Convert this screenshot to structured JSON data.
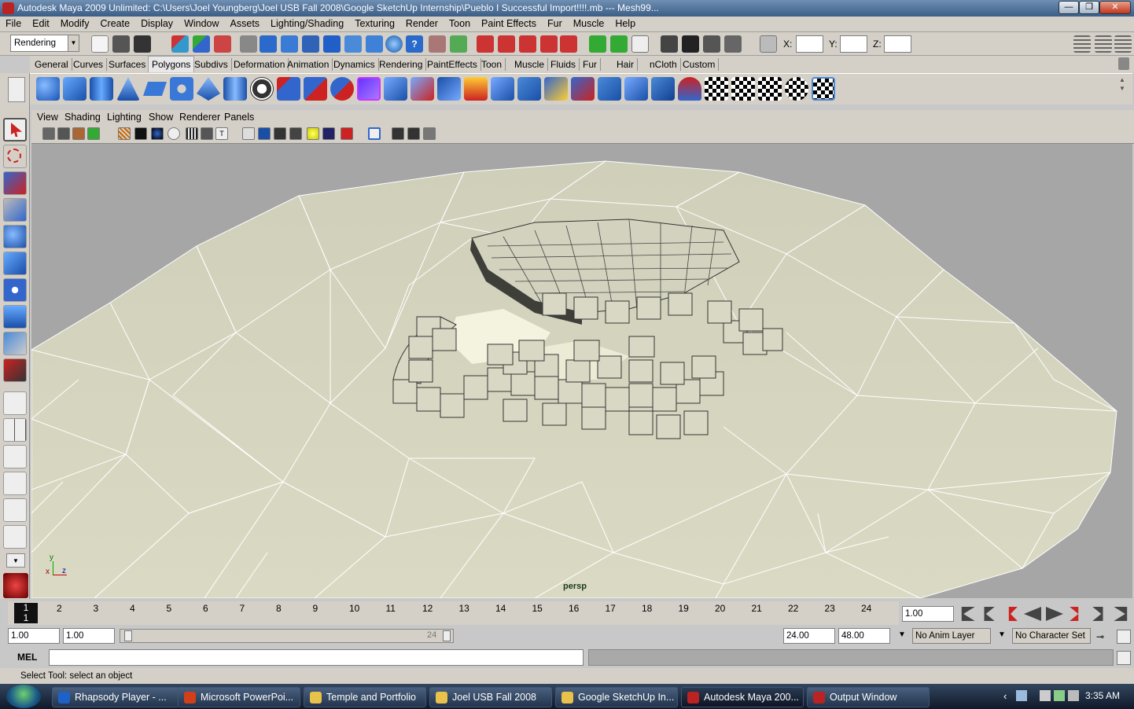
{
  "window": {
    "title": "Autodesk Maya 2009 Unlimited: C:\\Users\\Joel Youngberg\\Joel USB Fall 2008\\Google SketchUp Internship\\Pueblo I Successful Import!!!!.mb   ---   Mesh99...",
    "minimize": "—",
    "maximize": "❐",
    "close": "✕"
  },
  "menubar": [
    "File",
    "Edit",
    "Modify",
    "Create",
    "Display",
    "Window",
    "Assets",
    "Lighting/Shading",
    "Texturing",
    "Render",
    "Toon",
    "Paint Effects",
    "Fur",
    "Muscle",
    "Help"
  ],
  "statusline": {
    "menuset": "Rendering",
    "x_label": "X:",
    "y_label": "Y:",
    "z_label": "Z:"
  },
  "shelf_tabs": [
    "General",
    "Curves",
    "Surfaces",
    "Polygons",
    "Subdivs",
    "Deformation",
    "Animation",
    "Dynamics",
    "Rendering",
    "PaintEffects",
    "Toon",
    "Muscle",
    "Fluids",
    "Fur",
    "Hair",
    "nCloth",
    "Custom"
  ],
  "active_shelf": "Polygons",
  "panel_menu": [
    "View",
    "Shading",
    "Lighting",
    "Show",
    "Renderer",
    "Panels"
  ],
  "viewport": {
    "camera_label": "persp",
    "axis_y": "y",
    "axis_x": "x",
    "axis_z": "z"
  },
  "timeline": {
    "current_frame": "1",
    "ticks": [
      "2",
      "3",
      "4",
      "5",
      "6",
      "7",
      "8",
      "9",
      "10",
      "11",
      "12",
      "13",
      "14",
      "15",
      "16",
      "17",
      "18",
      "19",
      "20",
      "21",
      "22",
      "23",
      "24"
    ],
    "current_time": "1.00"
  },
  "range": {
    "start": "1.00",
    "playback_start": "1.00",
    "slider_label": "24",
    "playback_end": "24.00",
    "end": "48.00",
    "anim_layer": "No Anim Layer",
    "character_set": "No Character Set"
  },
  "mel": {
    "label": "MEL",
    "command": ""
  },
  "help_line": "Select Tool: select an object",
  "taskbar": {
    "items": [
      "Rhapsody Player - ...",
      "Microsoft PowerPoi...",
      "Temple and Portfolio",
      "Joel USB Fall 2008",
      "Google SketchUp In...",
      "Autodesk Maya 200...",
      "Output Window"
    ],
    "clock": "3:35 AM"
  },
  "colors": {
    "ui_gray": "#d4d0c8",
    "viewport_bg": "#a6a6a6",
    "mesh_fill": "#dcdcc8",
    "mesh_wire": "#ffffff",
    "title_blue": "#3b5e87"
  }
}
